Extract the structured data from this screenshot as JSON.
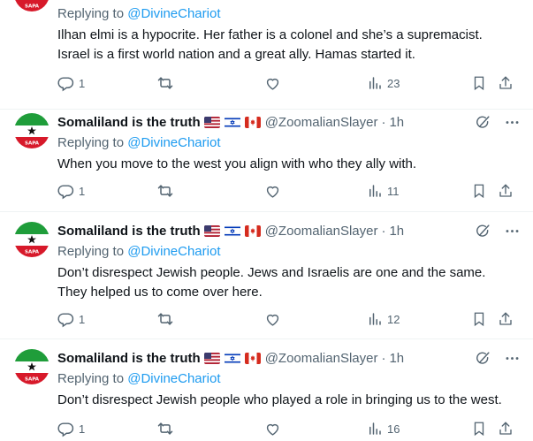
{
  "tweets": [
    {
      "reply_prefix": "Replying to ",
      "reply_handle": "@DivineChariot",
      "lines": [
        "Ilhan elmi is a hypocrite. Her father is a colonel and she’s a supremacist.",
        "Israel is a first world nation and a great ally. Hamas started it."
      ],
      "reply_count": "1",
      "views": "23"
    },
    {
      "display_name": "Somaliland is the truth",
      "handle": "@ZoomalianSlayer",
      "time": "1h",
      "reply_prefix": "Replying to ",
      "reply_handle": "@DivineChariot",
      "lines": [
        "When you move to the west you align with who they ally with."
      ],
      "reply_count": "1",
      "views": "11"
    },
    {
      "display_name": "Somaliland is the truth",
      "handle": "@ZoomalianSlayer",
      "time": "1h",
      "reply_prefix": "Replying to ",
      "reply_handle": "@DivineChariot",
      "lines": [
        "Don’t disrespect Jewish people. Jews and Israelis are one and the same.",
        "They helped us to come over here."
      ],
      "reply_count": "1",
      "views": "12"
    },
    {
      "display_name": "Somaliland is the truth",
      "handle": "@ZoomalianSlayer",
      "time": "1h",
      "reply_prefix": "Replying to ",
      "reply_handle": "@DivineChariot",
      "lines": [
        "Don’t disrespect Jewish people who played a role in bringing us to the west."
      ],
      "reply_count": "1",
      "views": "16"
    }
  ],
  "separator": "·",
  "avatar_badge": "SAPA",
  "icons": {
    "reply": "reply-icon",
    "retweet": "retweet-icon",
    "like": "like-icon",
    "views": "views-icon",
    "bookmark": "bookmark-icon",
    "share": "share-icon",
    "grok": "grok-icon",
    "more": "more-icon"
  },
  "colors": {
    "link": "#1d9bf0",
    "muted": "#536471",
    "text": "#0f1419",
    "divider": "#eff3f4",
    "avatar_green": "#1f9d3a",
    "avatar_red": "#d7192a"
  }
}
